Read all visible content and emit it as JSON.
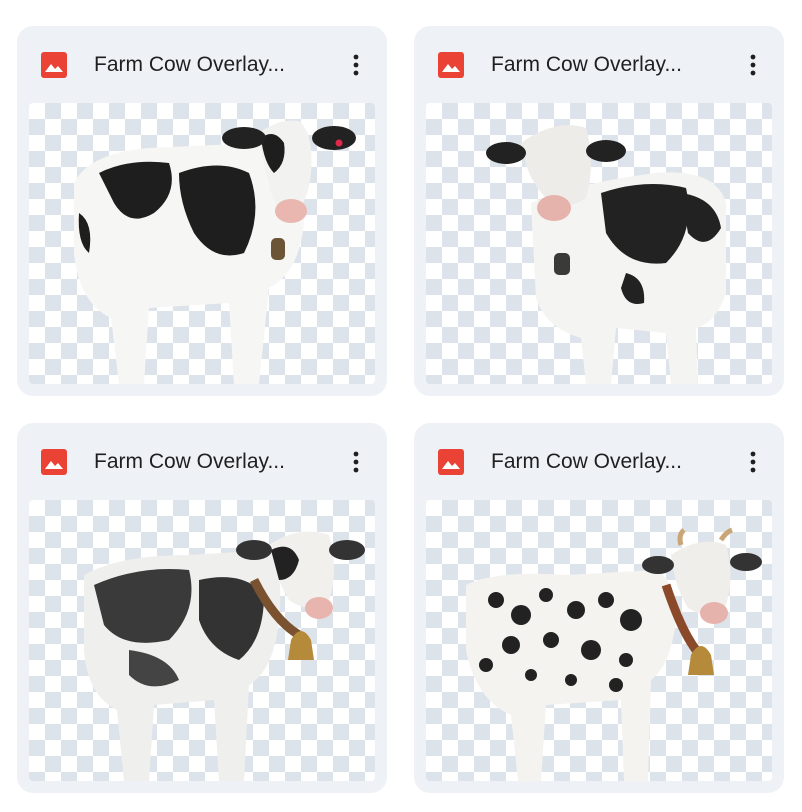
{
  "files": [
    {
      "name": "Farm Cow Overlay...",
      "icon": "image-file-icon",
      "menu_icon": "more-vert-icon"
    },
    {
      "name": "Farm Cow Overlay...",
      "icon": "image-file-icon",
      "menu_icon": "more-vert-icon"
    },
    {
      "name": "Farm Cow Overlay...",
      "icon": "image-file-icon",
      "menu_icon": "more-vert-icon"
    },
    {
      "name": "Farm Cow Overlay...",
      "icon": "image-file-icon",
      "menu_icon": "more-vert-icon"
    }
  ],
  "colors": {
    "card_bg": "#eef2f7",
    "image_icon": "#ea4335",
    "checker": "#dde3ea"
  }
}
